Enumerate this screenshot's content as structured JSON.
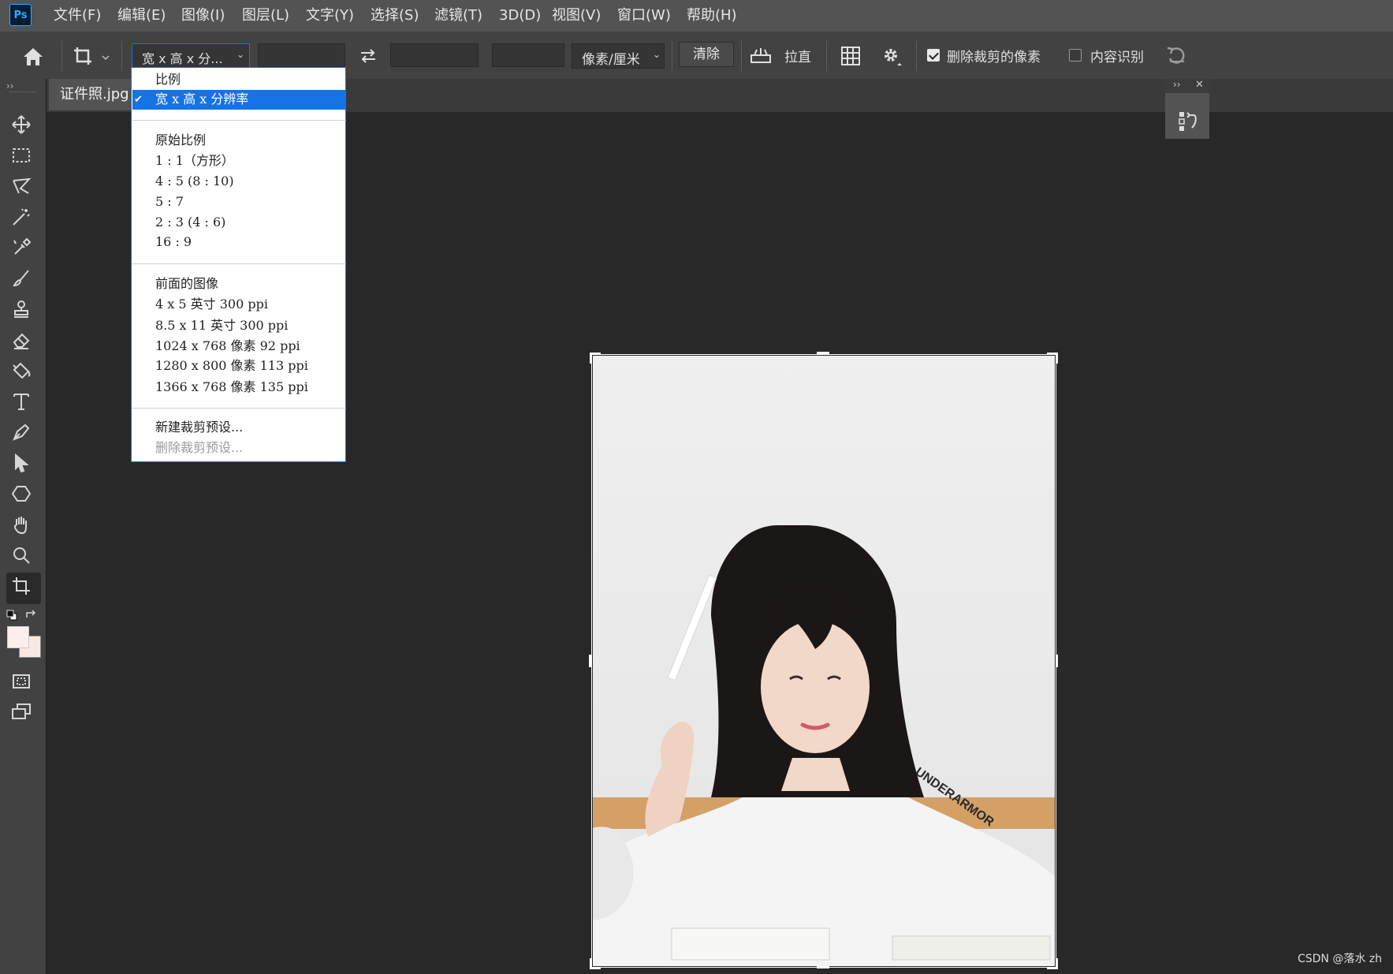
{
  "app": {
    "logo": "Ps"
  },
  "menu": [
    "文件(F)",
    "编辑(E)",
    "图像(I)",
    "图层(L)",
    "文字(Y)",
    "选择(S)",
    "滤镜(T)",
    "3D(D)",
    "视图(V)",
    "窗口(W)",
    "帮助(H)"
  ],
  "options": {
    "preset_select": "宽 x 高 x 分...",
    "width_value": "",
    "height_value": "",
    "resolution_value": "",
    "unit_select": "像素/厘米",
    "clear_button": "清除",
    "straighten_label": "拉直",
    "delete_cropped_label": "删除裁剪的像素",
    "delete_cropped_checked": true,
    "content_aware_label": "内容识别",
    "content_aware_checked": false
  },
  "document": {
    "tab_title": "证件照.jpg"
  },
  "dropdown": {
    "header_items": [
      {
        "label": "比例",
        "selected": false
      },
      {
        "label": "宽 x 高 x 分辨率",
        "selected": true
      }
    ],
    "ratio_items": [
      "原始比例",
      "1 : 1（方形）",
      "4 : 5 (8 : 10)",
      "5 : 7",
      "2 : 3 (4 : 6)",
      "16 : 9"
    ],
    "size_items": [
      "前面的图像",
      "4 x 5 英寸 300 ppi",
      "8.5 x 11 英寸 300 ppi",
      "1024 x 768 像素 92 ppi",
      "1280 x 800 像素 113 ppi",
      "1366 x 768 像素 135 ppi"
    ],
    "preset_actions": [
      {
        "label": "新建裁剪预设...",
        "enabled": true
      },
      {
        "label": "删除裁剪预设...",
        "enabled": false
      }
    ]
  },
  "shirt_text": "UNDERARMOR",
  "watermark": "CSDN @落水 zh",
  "colors": {
    "accent": "#1473e6",
    "foreground_swatch": "#fdeeee",
    "background_swatch": "#f6e9e3"
  },
  "icons": [
    "home-icon",
    "crop-icon",
    "swap-icon",
    "straighten-icon",
    "grid-icon",
    "gear-icon",
    "reset-icon"
  ]
}
